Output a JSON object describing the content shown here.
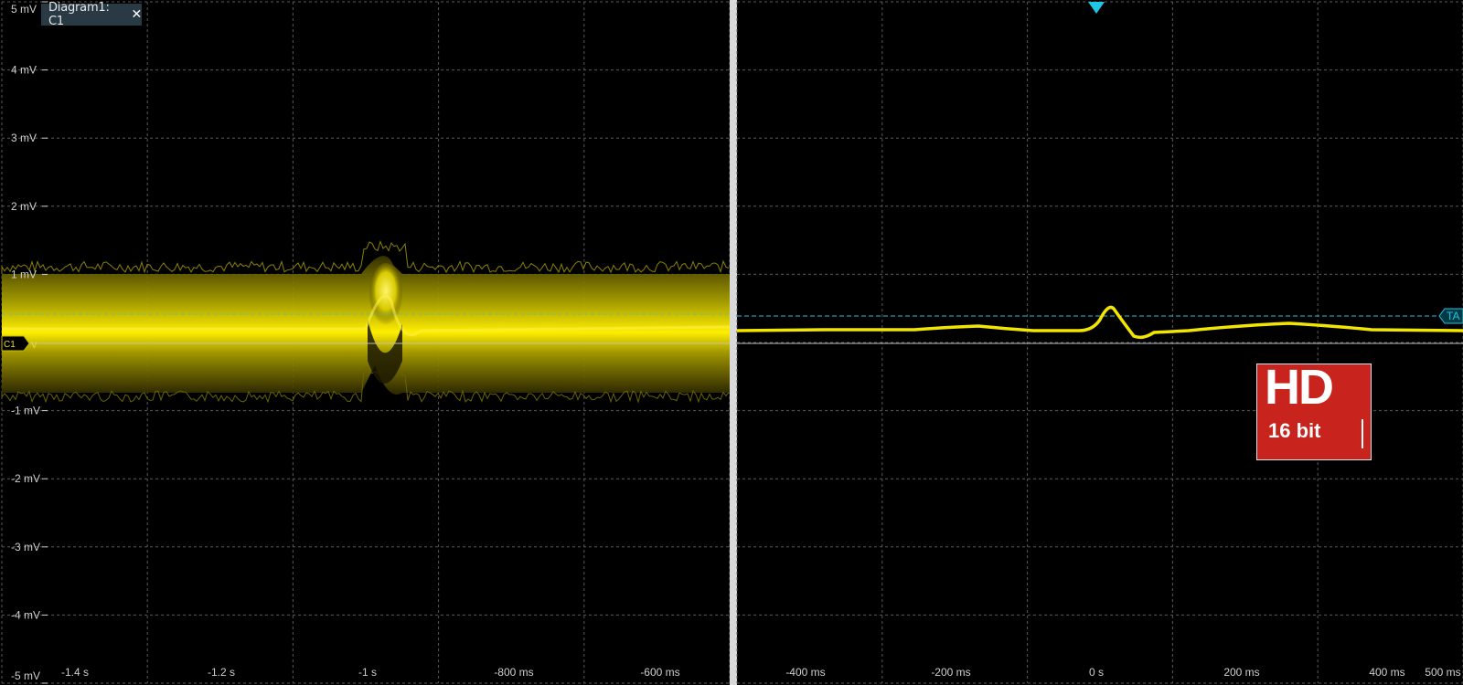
{
  "diagram_tab": {
    "label": "Diagram1: C1",
    "close_icon": "close-icon"
  },
  "left_panel": {
    "y_labels": [
      "5 mV",
      "4 mV",
      "3 mV",
      "2 mV",
      "1 mV",
      "-1 mV",
      "-2 mV",
      "-3 mV",
      "-4 mV",
      "-5 mV"
    ],
    "x_labels": [
      "-1.4 s",
      "-1.2 s",
      "-1 s",
      "-800 ms",
      "-600 ms"
    ],
    "channel_marker": "C1",
    "channel_marker_suffix": "V"
  },
  "right_panel": {
    "x_labels": [
      "-400 ms",
      "-200 ms",
      "0 s",
      "200 ms",
      "400 ms",
      "500 ms"
    ],
    "trigger_label": "TA",
    "trigger_position_icon": "trigger-position-icon"
  },
  "badge": {
    "big_text": "HD",
    "small_text": "16 bit"
  },
  "colors": {
    "trace": "#f2e600",
    "grid": "#5a5a5a",
    "axis": "#cfcfcf",
    "trigger": "#21c5e4",
    "badge_bg": "#c8231c",
    "tab_bg": "#2a3a44"
  }
}
